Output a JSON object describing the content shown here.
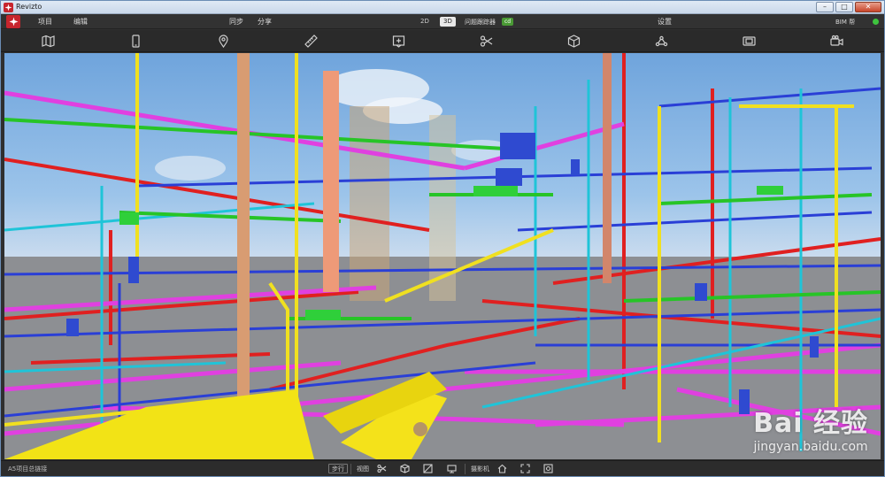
{
  "window": {
    "title": "Revizto",
    "buttons": {
      "minimize": "–",
      "maximize": "□",
      "close": "✕"
    }
  },
  "menubar": {
    "left_items": [
      "项目",
      "编辑"
    ],
    "center_items": [
      "同步",
      "分享"
    ],
    "view_modes": [
      "2D",
      "3D"
    ],
    "active_view_mode": "3D",
    "issue_tracker_label": "问题跟踪器",
    "issue_tracker_badge": "cd",
    "settings_label": "设置",
    "bim_label": "BIM 帮"
  },
  "toolbar": {
    "icons": [
      "map-icon",
      "phone-icon",
      "pin-icon",
      "ruler-icon",
      "add-markup-icon",
      "scissors-icon",
      "cube-icon",
      "share-node-icon",
      "screenshot-icon",
      "video-camera-icon"
    ]
  },
  "viewport": {
    "watermark_brand": "Bai 经验",
    "watermark_url": "jingyan.baidu.com"
  },
  "statusbar": {
    "left_text": "A5项目总链接",
    "walk_button": "步行",
    "views_label": "视图",
    "camera_label": "摄影机"
  },
  "colors": {
    "accent_red": "#c7252d",
    "badge_green": "#4a9a35",
    "status_green": "#3ec43e"
  }
}
